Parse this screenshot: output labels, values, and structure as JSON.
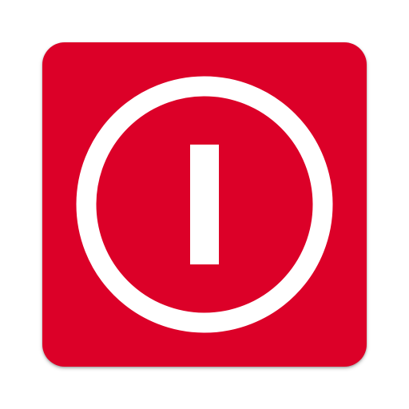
{
  "app_icon": {
    "icon": "power-switch-icon",
    "colors": {
      "background": "#dc0028",
      "foreground": "#ffffff",
      "page": "#ffffff"
    }
  }
}
